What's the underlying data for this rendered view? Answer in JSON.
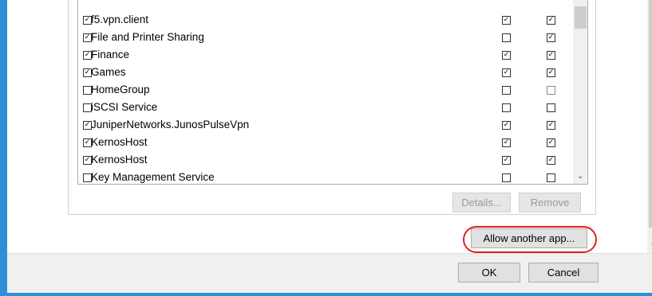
{
  "apps": {
    "rows": [
      {
        "name": "f5.vpn.client",
        "checked": true,
        "private": true,
        "public": true
      },
      {
        "name": "File and Printer Sharing",
        "checked": true,
        "private": false,
        "public": true
      },
      {
        "name": "Finance",
        "checked": true,
        "private": true,
        "public": true
      },
      {
        "name": "Games",
        "checked": true,
        "private": true,
        "public": true
      },
      {
        "name": "HomeGroup",
        "checked": false,
        "private": false,
        "public": false
      },
      {
        "name": "iSCSI Service",
        "checked": false,
        "private": false,
        "public": false
      },
      {
        "name": "JuniperNetworks.JunosPulseVpn",
        "checked": true,
        "private": true,
        "public": true
      },
      {
        "name": "KernosHost",
        "checked": true,
        "private": true,
        "public": true
      },
      {
        "name": "KernosHost",
        "checked": true,
        "private": true,
        "public": true
      },
      {
        "name": "Key Management Service",
        "checked": false,
        "private": false,
        "public": false
      }
    ]
  },
  "buttons": {
    "details": "Details...",
    "remove": "Remove",
    "allow_another_app": "Allow another app...",
    "ok": "OK",
    "cancel": "Cancel"
  },
  "colors": {
    "window_border": "#2e8fd6",
    "highlight_circle": "#e02020"
  },
  "icons": {
    "list_scroll_down": "chevron-down-icon",
    "page_scroll_down": "chevron-down-icon"
  }
}
